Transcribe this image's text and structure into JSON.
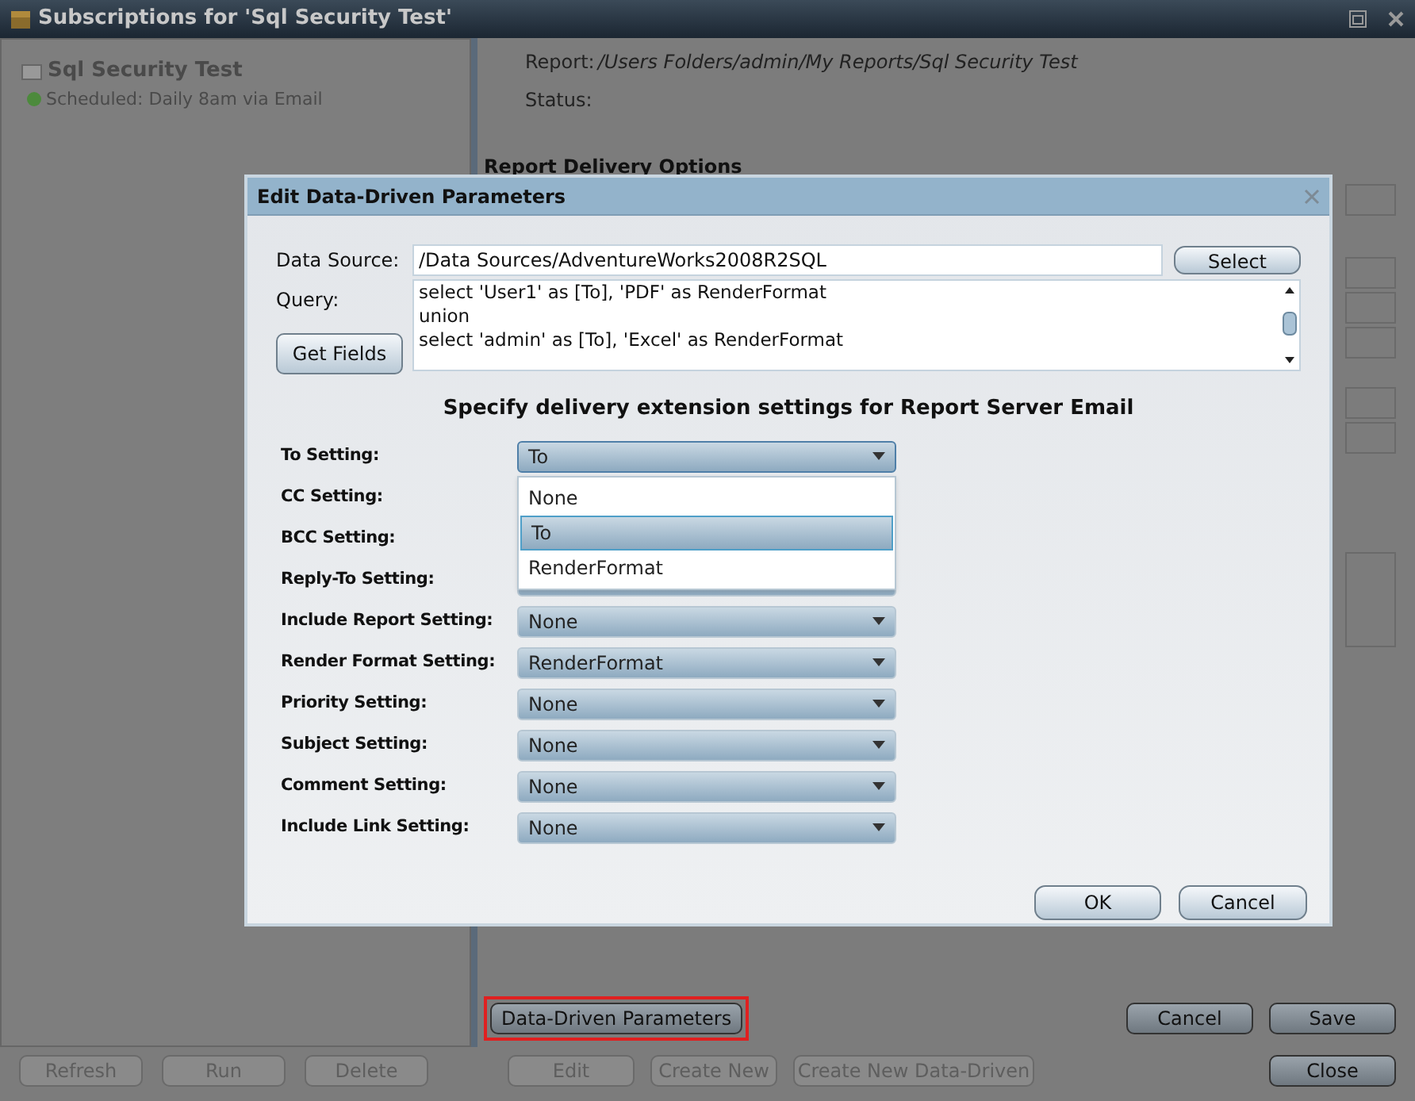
{
  "window": {
    "title": "Subscriptions for 'Sql Security Test'"
  },
  "sidebar": {
    "items": [
      {
        "name": "Sql Security Test",
        "schedule": "Scheduled: Daily 8am via Email",
        "selected": false
      }
    ]
  },
  "details": {
    "report_label": "Report:",
    "report_path": "/Users Folders/admin/My Reports/Sql Security Test",
    "status_label": "Status:",
    "section_title": "Report Delivery Options"
  },
  "sidebar_buttons": [
    {
      "label": "Refresh",
      "disabled": true
    },
    {
      "label": "Run",
      "disabled": true
    },
    {
      "label": "Delete",
      "disabled": true
    }
  ],
  "footer_buttons": [
    {
      "label": "Edit",
      "disabled": true
    },
    {
      "label": "Create New",
      "disabled": true
    },
    {
      "label": "Create New Data-Driven",
      "disabled": true
    }
  ],
  "data_driven_button": {
    "label": "Data-Driven Parameters",
    "highlighted": true
  },
  "action_buttons": [
    {
      "label": "Cancel",
      "disabled": false
    },
    {
      "label": "Save",
      "disabled": false
    }
  ],
  "close_button": {
    "label": "Close",
    "disabled": false
  },
  "dialog": {
    "title": "Edit Data-Driven Parameters",
    "data_source_label": "Data Source:",
    "data_source": "/Data Sources/AdventureWorks2008R2SQL",
    "select_button": "Select",
    "query_label": "Query:",
    "get_fields_button": "Get Fields",
    "query_lines": [
      "select 'User1' as [To], 'PDF' as RenderFormat",
      "union",
      "select 'admin' as [To], 'Excel' as RenderFormat"
    ],
    "heading": "Specify delivery extension settings for Report Server Email",
    "settings": [
      {
        "label": "To Setting:",
        "value": "To",
        "expanded": true
      },
      {
        "label": "CC Setting:",
        "expanded": false
      },
      {
        "label": "BCC Setting:",
        "expanded": false
      },
      {
        "label": "Reply-To Setting:",
        "expanded": false
      },
      {
        "label": "Include Report Setting:",
        "value": "None",
        "expanded": false
      },
      {
        "label": "Render Format Setting:",
        "value": "RenderFormat",
        "expanded": false
      },
      {
        "label": "Priority Setting:",
        "value": "None",
        "expanded": false
      },
      {
        "label": "Subject Setting:",
        "value": "None",
        "expanded": false
      },
      {
        "label": "Comment Setting:",
        "value": "None",
        "expanded": false
      },
      {
        "label": "Include Link Setting:",
        "value": "None",
        "expanded": false
      }
    ],
    "dropdown_options": [
      {
        "label": "None",
        "selected": false
      },
      {
        "label": "To",
        "selected": true
      },
      {
        "label": "RenderFormat",
        "selected": false
      }
    ],
    "ok_button": "OK",
    "cancel_button": "Cancel"
  }
}
